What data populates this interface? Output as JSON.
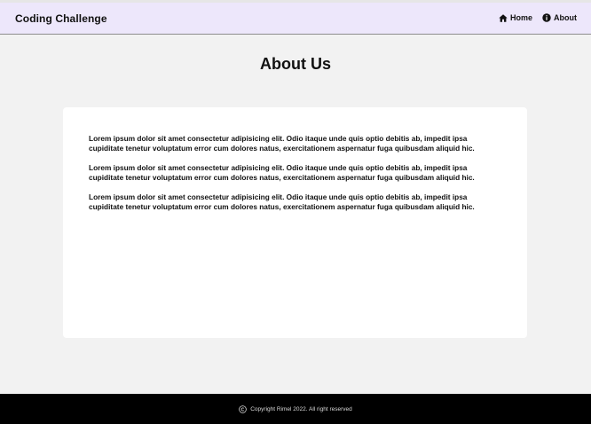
{
  "navbar": {
    "brand": "Coding Challenge",
    "links": [
      {
        "label": "Home",
        "icon": "home-icon"
      },
      {
        "label": "About",
        "icon": "info-icon"
      }
    ]
  },
  "main": {
    "title": "About Us",
    "paragraphs": [
      "Lorem ipsum dolor sit amet consectetur adipisicing elit. Odio itaque unde quis optio debitis ab, impedit ipsa cupiditate tenetur voluptatum error cum dolores natus, exercitationem aspernatur fuga quibusdam aliquid hic.",
      "Lorem ipsum dolor sit amet consectetur adipisicing elit. Odio itaque unde quis optio debitis ab, impedit ipsa cupiditate tenetur voluptatum error cum dolores natus, exercitationem aspernatur fuga quibusdam aliquid hic.",
      "Lorem ipsum dolor sit amet consectetur adipisicing elit. Odio itaque unde quis optio debitis ab, impedit ipsa cupiditate tenetur voluptatum error cum dolores natus, exercitationem aspernatur fuga quibusdam aliquid hic."
    ]
  },
  "footer": {
    "text": "Copyright Rimel 2022. All right reserved",
    "icon": "copyright-icon"
  },
  "colors": {
    "navbar_bg": "#ede7fb",
    "page_bg": "#f2f2f2",
    "card_bg": "#ffffff",
    "footer_bg": "#000000"
  }
}
